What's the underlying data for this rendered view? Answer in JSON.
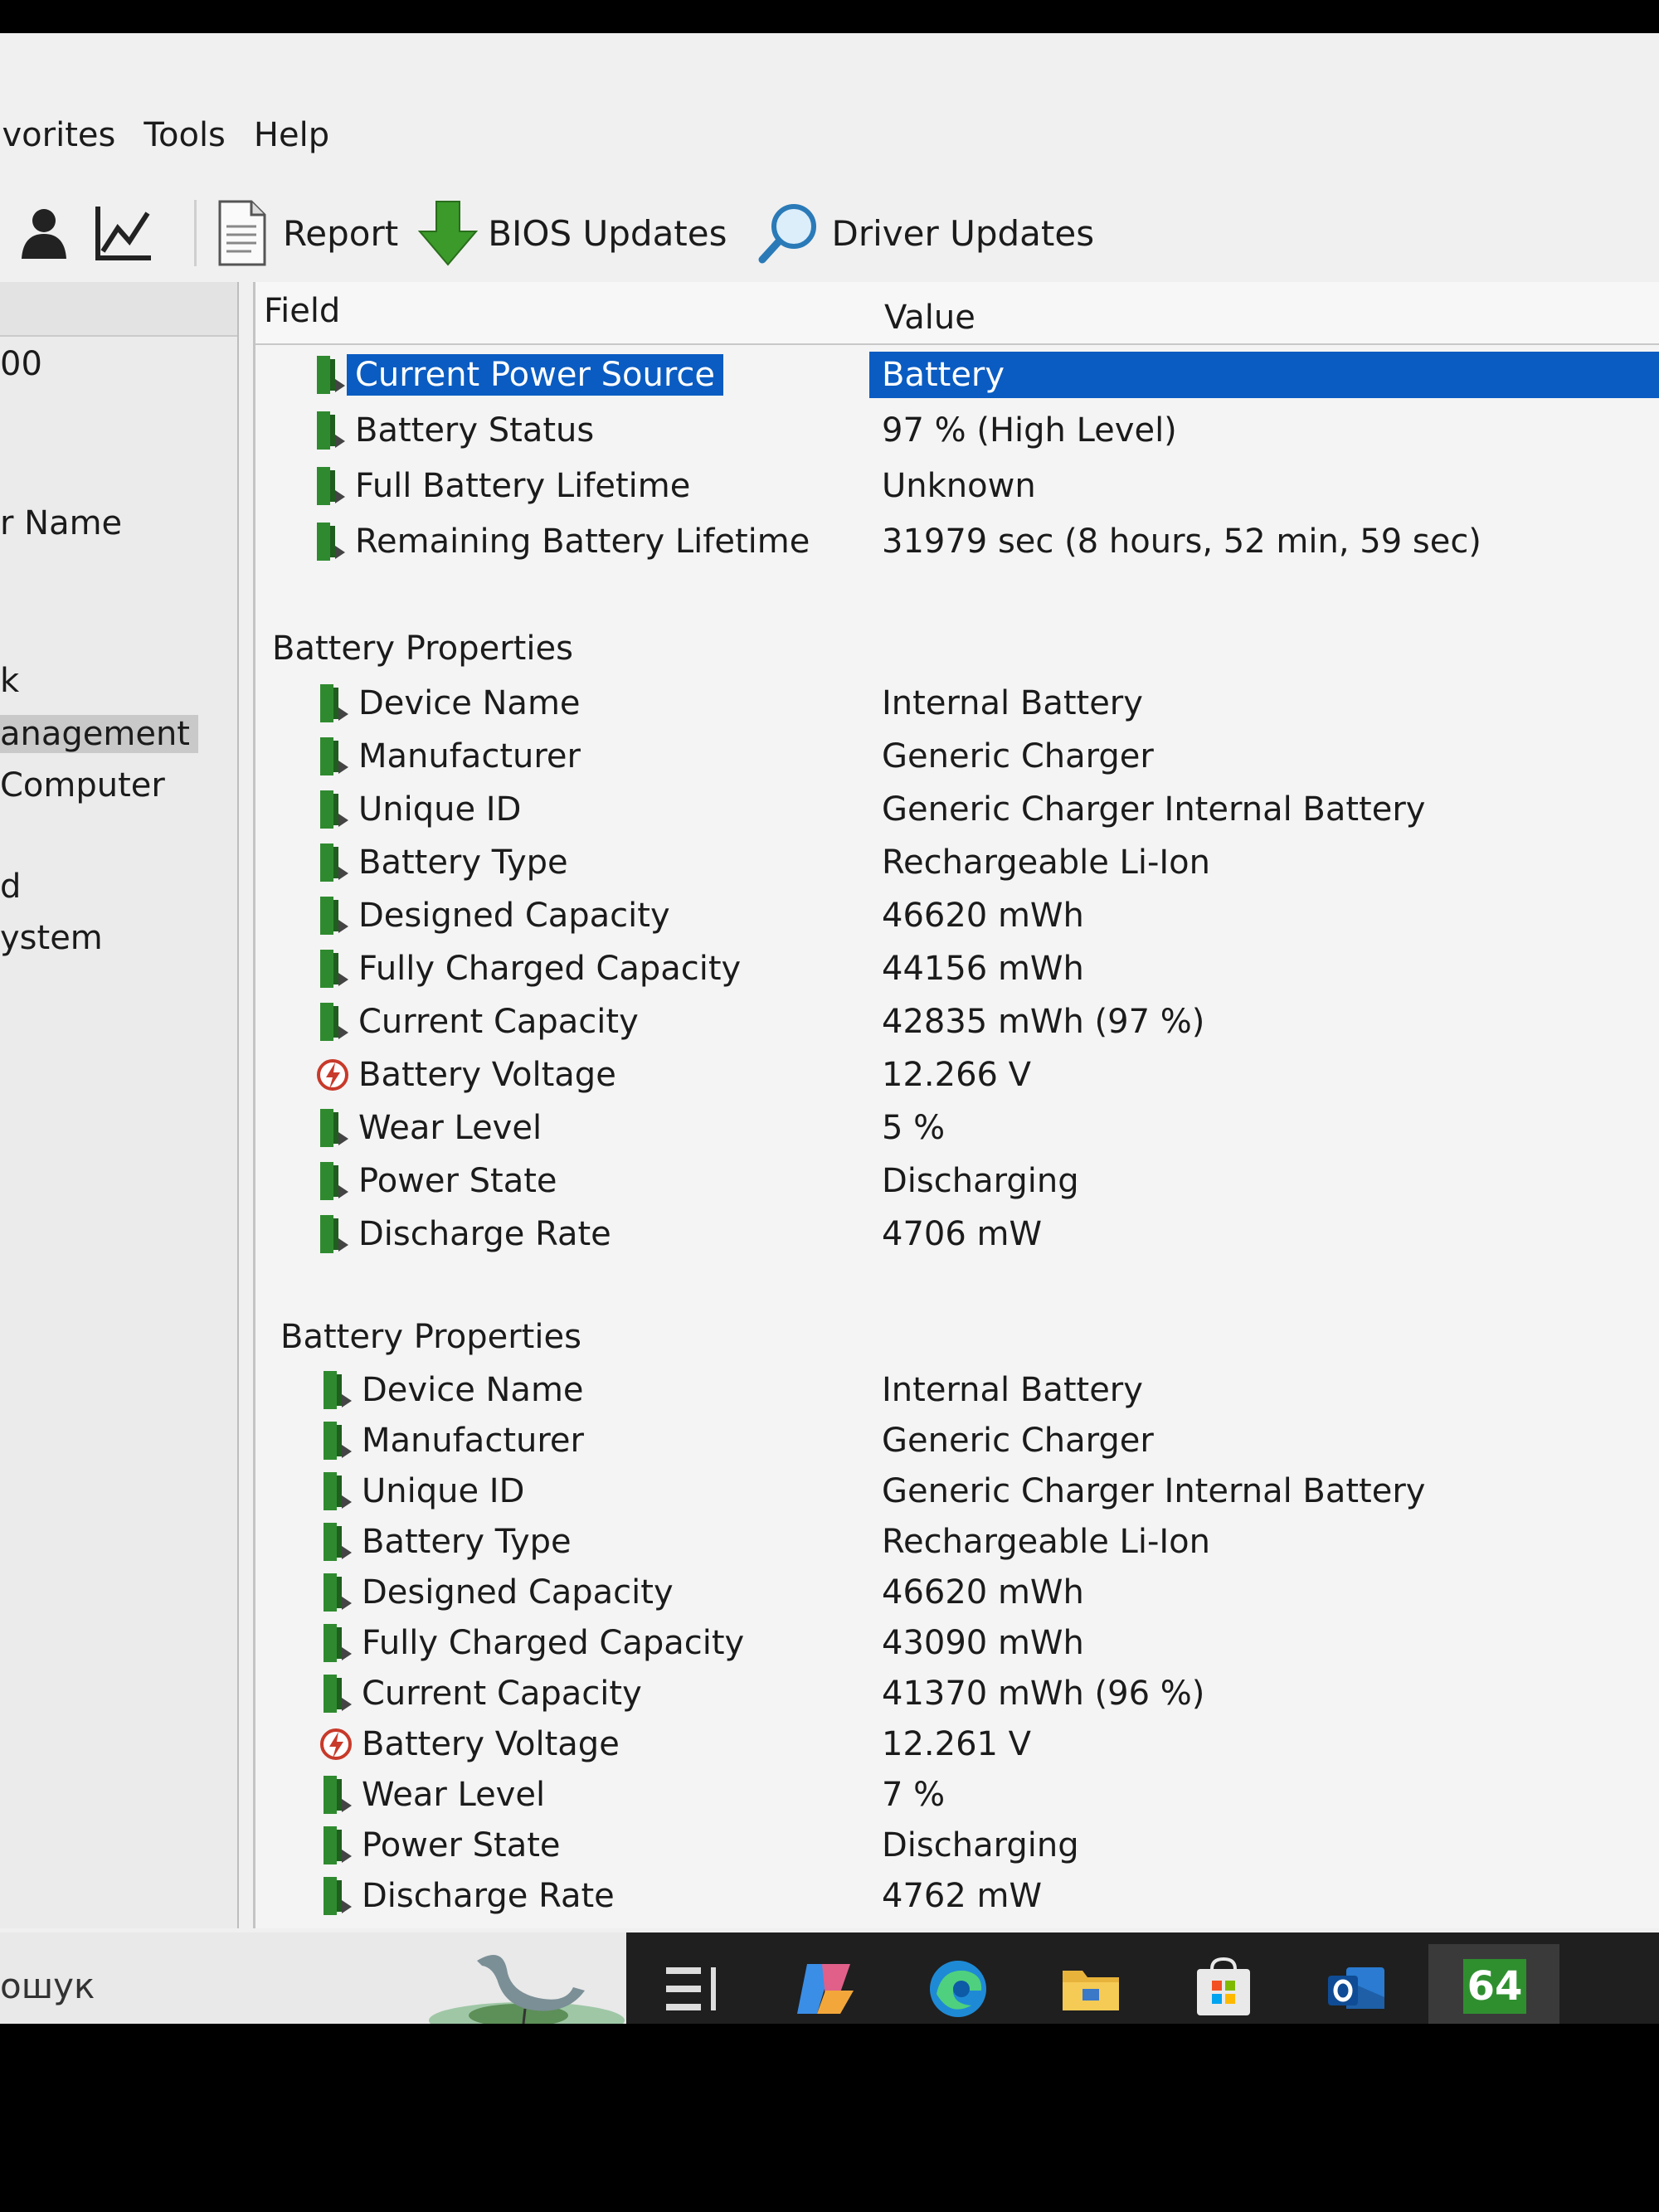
{
  "menu": {
    "items": [
      "avorites",
      "Tools",
      "Help"
    ]
  },
  "toolbar": {
    "report_label": "Report",
    "bios_label": "BIOS Updates",
    "driver_label": "Driver Updates"
  },
  "left_pane": {
    "items": [
      "00",
      "r Name",
      "k",
      "anagement",
      "Computer",
      "d",
      "ystem"
    ],
    "selected_index": 3
  },
  "columns": {
    "field": "Field",
    "value": "Value"
  },
  "power": [
    {
      "field": "Current Power Source",
      "value": "Battery",
      "selected": true
    },
    {
      "field": "Battery Status",
      "value": "97 % (High Level)"
    },
    {
      "field": "Full Battery Lifetime",
      "value": "Unknown"
    },
    {
      "field": "Remaining Battery Lifetime",
      "value": "31979 sec (8 hours, 52 min, 59 sec)"
    }
  ],
  "battery1": {
    "title": "Battery Properties",
    "rows": [
      {
        "field": "Device Name",
        "value": "Internal Battery"
      },
      {
        "field": "Manufacturer",
        "value": "Generic Charger"
      },
      {
        "field": "Unique ID",
        "value": "Generic Charger Internal Battery"
      },
      {
        "field": "Battery Type",
        "value": "Rechargeable Li-Ion"
      },
      {
        "field": "Designed Capacity",
        "value": "46620 mWh"
      },
      {
        "field": "Fully Charged Capacity",
        "value": "44156 mWh"
      },
      {
        "field": "Current Capacity",
        "value": "42835 mWh  (97 %)"
      },
      {
        "field": "Battery Voltage",
        "value": "12.266 V",
        "icon": "voltage"
      },
      {
        "field": "Wear Level",
        "value": "5 %"
      },
      {
        "field": "Power State",
        "value": "Discharging"
      },
      {
        "field": "Discharge Rate",
        "value": "4706 mW"
      }
    ]
  },
  "battery2": {
    "title": "Battery Properties",
    "rows": [
      {
        "field": "Device Name",
        "value": "Internal Battery"
      },
      {
        "field": "Manufacturer",
        "value": "Generic Charger"
      },
      {
        "field": "Unique ID",
        "value": "Generic Charger Internal Battery"
      },
      {
        "field": "Battery Type",
        "value": "Rechargeable Li-Ion"
      },
      {
        "field": "Designed Capacity",
        "value": "46620 mWh"
      },
      {
        "field": "Fully Charged Capacity",
        "value": "43090 mWh"
      },
      {
        "field": "Current Capacity",
        "value": "41370 mWh  (96 %)"
      },
      {
        "field": "Battery Voltage",
        "value": "12.261 V",
        "icon": "voltage"
      },
      {
        "field": "Wear Level",
        "value": "7 %"
      },
      {
        "field": "Power State",
        "value": "Discharging"
      },
      {
        "field": "Discharge Rate",
        "value": "4762 mW"
      }
    ]
  },
  "taskbar": {
    "search_text": "ошук",
    "active_app_label": "64"
  },
  "colors": {
    "selection": "#0a5cc2",
    "battery_icon": "#2f8a2f",
    "voltage_icon": "#c83a2a"
  }
}
